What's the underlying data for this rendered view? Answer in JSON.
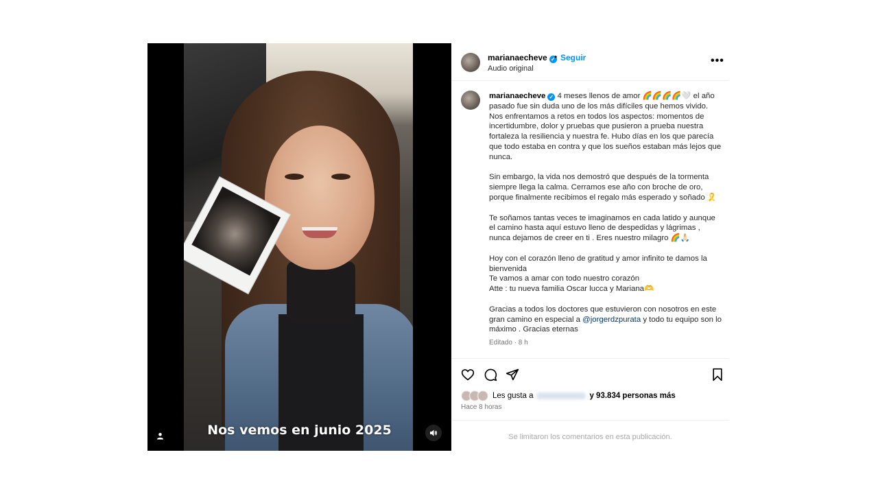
{
  "media": {
    "overlay_text": "Nos vemos en junio 2025"
  },
  "post": {
    "username": "marianaecheve",
    "verified_icon": "verified-badge-icon",
    "separator": "•",
    "follow_label": "Seguir",
    "audio_label": "Audio original",
    "more_icon": "more-options-icon"
  },
  "caption": {
    "p1": "4 meses llenos de amor 🌈🌈🌈🌈🤍 el año pasado fue sin duda uno de los más difíciles que hemos vivido. Nos enfrentamos a retos en todos los aspectos: momentos de incertidumbre, dolor y pruebas que pusieron a prueba nuestra fortaleza la resiliencia y nuestra fe. Hubo días en los que parecía que todo estaba en contra y que los sueños estaban más lejos que nunca.",
    "p2": "Sin embargo, la vida nos demostró que después de la tormenta siempre llega la calma. Cerramos ese año con broche de oro, porque finalmente recibimos el regalo más esperado y soñado 🎗️",
    "p3": "Te soñamos tantas veces te imaginamos en cada latido y aunque el camino hasta aquí estuvo lleno de despedidas y lágrimas , nunca dejamos de creer en ti . Eres nuestro milagro 🌈🙏🏻",
    "p4": "Hoy con el corazón lleno de gratitud y amor infinito te damos la bienvenida\nTe vamos a amar con todo nuestro corazón\nAtte : tu nueva familia Oscar lucca y Mariana🫶",
    "p5_before": "Gracias a todos los doctores que estuvieron con nosotros en este gran camino en especial a ",
    "p5_mention": "@jorgerdzpurata",
    "p5_after": " y todo tu equipo son lo máximo . Gracias eternas",
    "edited": "Editado · 8 h"
  },
  "actions": {
    "likes_prefix": "Les gusta a",
    "likes_suffix": "y 93.834 personas más",
    "time_ago": "Hace 8 horas",
    "comments_disabled": "Se limitaron los comentarios en esta publicación."
  }
}
